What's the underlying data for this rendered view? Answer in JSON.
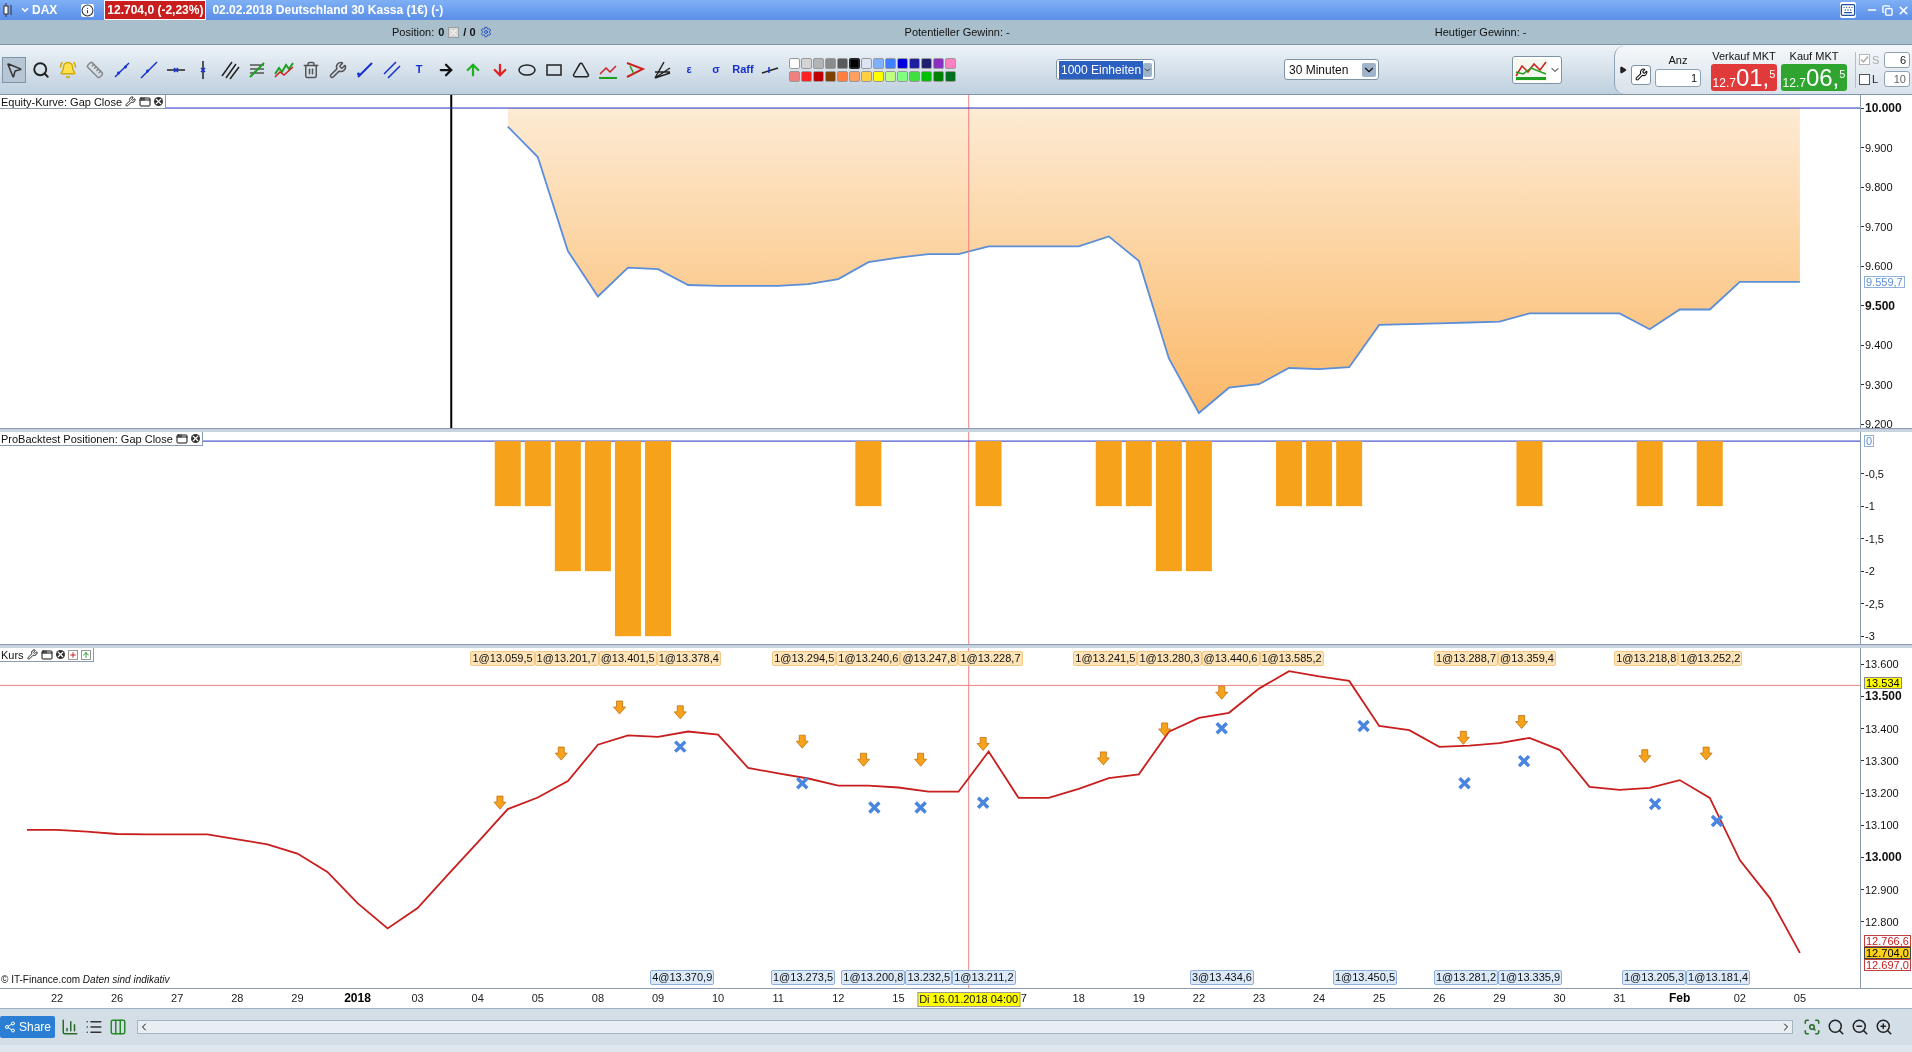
{
  "window": {
    "symbol": "DAX",
    "price_badge": "12.704,0 (-2,23%)",
    "title": "02.02.2018 Deutschland 30 Kassa (1€) (-)"
  },
  "info_bar": {
    "position_label": "Position:",
    "position_value": "0",
    "position_sep": "/ 0",
    "potential_gain": "Potentieller Gewinn: -",
    "today_gain": "Heutiger Gewinn: -"
  },
  "toolbar": {
    "tools": [
      {
        "kind": "icon",
        "selected": true
      },
      {
        "kind": "icon",
        "selected": false
      },
      {
        "kind": "icon",
        "selected": false
      },
      {
        "kind": "icon",
        "selected": false
      },
      {
        "kind": "icon",
        "selected": false
      },
      {
        "kind": "icon",
        "selected": false
      },
      {
        "kind": "icon",
        "selected": false
      },
      {
        "kind": "icon",
        "selected": false
      },
      {
        "kind": "icon",
        "selected": false
      },
      {
        "kind": "icon",
        "selected": false
      },
      {
        "kind": "icon",
        "selected": false
      },
      {
        "kind": "icon",
        "selected": false
      },
      {
        "kind": "icon",
        "selected": false
      },
      {
        "kind": "icon",
        "selected": false
      },
      {
        "kind": "icon",
        "selected": false
      },
      {
        "kind": "glyph",
        "label": "T",
        "selected": false
      },
      {
        "kind": "icon",
        "selected": false
      },
      {
        "kind": "icon",
        "selected": false
      },
      {
        "kind": "icon",
        "selected": false
      },
      {
        "kind": "icon",
        "selected": false
      },
      {
        "kind": "icon",
        "selected": false
      },
      {
        "kind": "icon",
        "selected": false
      },
      {
        "kind": "icon",
        "selected": false
      },
      {
        "kind": "icon",
        "selected": false
      },
      {
        "kind": "icon",
        "selected": false
      },
      {
        "kind": "glyph",
        "label": "ε",
        "selected": false
      },
      {
        "kind": "glyph",
        "label": "σ",
        "selected": false
      },
      {
        "kind": "glyph",
        "label": "Raff",
        "selected": false
      },
      {
        "kind": "icon",
        "selected": false
      }
    ],
    "palette": [
      [
        {
          "color": "#ffffff",
          "selected": false
        },
        {
          "color": "#d4d4d4",
          "selected": false
        },
        {
          "color": "#b4b4b4",
          "selected": false
        },
        {
          "color": "#8c8c8c",
          "selected": false
        },
        {
          "color": "#5a5a5a",
          "selected": false
        },
        {
          "color": "#000000",
          "selected": true
        },
        {
          "color": "#dce4f4",
          "selected": false
        },
        {
          "color": "#7fb0ff",
          "selected": false
        },
        {
          "color": "#3f7fff",
          "selected": false
        },
        {
          "color": "#0000dd",
          "selected": false
        },
        {
          "color": "#1e1ea0",
          "selected": false
        },
        {
          "color": "#20206e",
          "selected": false
        },
        {
          "color": "#8a2fc0",
          "selected": false
        },
        {
          "color": "#ff80c0",
          "selected": false
        }
      ],
      [
        {
          "color": "#f08080",
          "selected": false
        },
        {
          "color": "#ff2020",
          "selected": false
        },
        {
          "color": "#c00000",
          "selected": false
        },
        {
          "color": "#804000",
          "selected": false
        },
        {
          "color": "#ff8040",
          "selected": false
        },
        {
          "color": "#ffa060",
          "selected": false
        },
        {
          "color": "#ffd040",
          "selected": false
        },
        {
          "color": "#ffff00",
          "selected": false
        },
        {
          "color": "#c0ff80",
          "selected": false
        },
        {
          "color": "#80ff80",
          "selected": false
        },
        {
          "color": "#40e040",
          "selected": false
        },
        {
          "color": "#00c000",
          "selected": false
        },
        {
          "color": "#008000",
          "selected": false
        },
        {
          "color": "#007020",
          "selected": false
        }
      ]
    ],
    "units": {
      "value": "1000 Einheiten",
      "selected": true
    },
    "period": {
      "value": "30 Minuten",
      "selected": false
    }
  },
  "order_panel": {
    "quantity_label": "Anz",
    "quantity": "1",
    "sell_label": "Verkauf MKT",
    "sell": {
      "prefix": "12.7",
      "main": "01,",
      "sup": "5"
    },
    "buy_label": "Kauf MKT",
    "buy": {
      "prefix": "12.7",
      "main": "06,",
      "sup": "5"
    },
    "options": [
      {
        "label": "S",
        "checked": true,
        "disabled": true,
        "value": "6"
      },
      {
        "label": "L",
        "checked": false,
        "disabled": false,
        "value": "10"
      }
    ]
  },
  "panels": [
    {
      "kind": "equity",
      "title": "Equity-Kurve: Gap Close",
      "buttons": [
        {
          "kind": "wrench"
        },
        {
          "kind": "window"
        },
        {
          "kind": "close"
        }
      ],
      "badges": [
        {
          "kind": "last"
        }
      ],
      "chart_data": {
        "type": "line",
        "ylim": [
          9190,
          10033
        ],
        "yticks": [
          {
            "value": 10000,
            "label": "10.000"
          },
          {
            "value": 9900,
            "label": "9.900"
          },
          {
            "value": 9800,
            "label": "9.800"
          },
          {
            "value": 9700,
            "label": "9.700"
          },
          {
            "value": 9600,
            "label": "9.600"
          },
          {
            "value": 9500,
            "label": "9.500"
          },
          {
            "value": 9400,
            "label": "9.400"
          },
          {
            "value": 9300,
            "label": "9.300"
          },
          {
            "value": 9200,
            "label": "9.200"
          }
        ],
        "categories": [
          null,
          null,
          null,
          null,
          null,
          null,
          null,
          null,
          null,
          null,
          null,
          null,
          null,
          null,
          null,
          null,
          null,
          null,
          null,
          null,
          null,
          null,
          null,
          null,
          null,
          null,
          null,
          null,
          null,
          null,
          null,
          null,
          null,
          null,
          null,
          null,
          null,
          null,
          null,
          null,
          null,
          null,
          null,
          null,
          null,
          null,
          null,
          null,
          null,
          null,
          null,
          null,
          null,
          null,
          null,
          null,
          null,
          null,
          null,
          null
        ],
        "series": [
          {
            "color": "#5b8ed8",
            "values": [
              null,
              null,
              null,
              null,
              null,
              null,
              null,
              null,
              null,
              null,
              null,
              null,
              null,
              null,
              null,
              null,
              9953,
              9876,
              9638,
              9523,
              9596,
              9592,
              9552,
              9550,
              9550,
              9550,
              9554,
              9567,
              9610,
              9621,
              9630,
              9630,
              9650,
              9650,
              9650,
              9650,
              9675,
              9613,
              9366,
              9228,
              9292,
              9301,
              9342,
              9339,
              9344,
              9451,
              9453,
              9455,
              9457,
              9459,
              9480,
              9480,
              9480,
              9480,
              9440,
              9490,
              9490,
              9560,
              9560,
              9560
            ]
          }
        ],
        "ref_lines": [
          {
            "axis": "y",
            "value": 10000
          }
        ],
        "annotations": [
          "9.559,7"
        ]
      }
    },
    {
      "kind": "positions",
      "title": "ProBacktest Positionen: Gap Close",
      "buttons": [
        {
          "kind": "window"
        },
        {
          "kind": "close"
        }
      ],
      "badges": [
        {
          "kind": "baseline"
        }
      ],
      "chart_data": {
        "type": "bar",
        "ylim": [
          -3.12,
          0.14
        ],
        "yticks": [
          {
            "value": -0.5,
            "label": "-0,5"
          },
          {
            "value": -1,
            "label": "-1"
          },
          {
            "value": -1.5,
            "label": "-1,5"
          },
          {
            "value": -2,
            "label": "-2"
          },
          {
            "value": -2.5,
            "label": "-2,5"
          },
          {
            "value": -3,
            "label": "-3"
          }
        ],
        "categories": [
          null,
          null,
          null,
          null,
          null,
          null,
          null,
          null,
          null,
          null,
          null,
          null,
          null,
          null,
          null,
          null,
          null,
          null,
          null,
          null,
          null,
          null,
          null,
          null,
          null,
          null,
          null,
          null,
          null,
          null,
          null,
          null,
          null,
          null,
          null,
          null,
          null,
          null,
          null,
          null,
          null,
          null,
          null,
          null,
          null,
          null,
          null,
          null,
          null,
          null,
          null,
          null,
          null,
          null,
          null,
          null,
          null,
          null,
          null,
          null
        ],
        "series": [
          {
            "color": "#f7a21b",
            "values": [
              null,
              null,
              null,
              null,
              null,
              null,
              null,
              null,
              null,
              null,
              null,
              null,
              null,
              null,
              null,
              null,
              -1,
              -1,
              -2,
              -2,
              -3,
              -3,
              null,
              null,
              null,
              null,
              null,
              null,
              -1,
              null,
              null,
              null,
              -1,
              null,
              null,
              null,
              -1,
              -1,
              -2,
              -2,
              null,
              null,
              -1,
              -1,
              -1,
              null,
              null,
              null,
              null,
              null,
              -1,
              null,
              null,
              null,
              -1,
              null,
              -1,
              null,
              null,
              null
            ]
          }
        ],
        "ref_lines": [
          {
            "axis": "y",
            "value": 0
          }
        ],
        "annotations": [
          "0"
        ]
      }
    },
    {
      "kind": "price",
      "title": "Kurs",
      "buttons": [
        {
          "kind": "wrench"
        },
        {
          "kind": "window"
        },
        {
          "kind": "close"
        },
        {
          "kind": "add"
        },
        {
          "kind": "up"
        }
      ],
      "badges": [
        {
          "kind": "cursor"
        },
        {
          "kind": "high"
        },
        {
          "kind": "current"
        },
        {
          "kind": "low"
        }
      ],
      "cursor_label": "Di 16.01.2018 04:00",
      "partial_tick": "7",
      "date_bold": [
        false,
        false,
        false,
        false,
        false,
        true,
        false,
        false,
        false,
        false,
        false,
        false,
        false,
        false,
        false,
        false,
        false,
        false,
        false,
        false,
        false,
        false,
        false,
        false,
        false,
        true,
        false,
        false
      ],
      "chart_data": {
        "type": "line",
        "ylim": [
          12595,
          13650
        ],
        "categories": [
          null,
          "22",
          null,
          "26",
          null,
          "27",
          null,
          "28",
          null,
          "29",
          null,
          "2018",
          null,
          "03",
          null,
          "04",
          null,
          "05",
          null,
          "08",
          null,
          "09",
          null,
          "10",
          null,
          "11",
          null,
          "12",
          null,
          "15",
          null,
          null,
          null,
          null,
          null,
          "18",
          null,
          "19",
          null,
          "22",
          null,
          "23",
          null,
          "24",
          null,
          "25",
          null,
          "26",
          null,
          "29",
          null,
          "30",
          null,
          "31",
          null,
          "Feb",
          null,
          "02",
          null,
          "05"
        ],
        "yticks": [
          {
            "value": 13600,
            "label": "13.600"
          },
          {
            "value": 13500,
            "label": "13.500"
          },
          {
            "value": 13400,
            "label": "13.400"
          },
          {
            "value": 13300,
            "label": "13.300"
          },
          {
            "value": 13200,
            "label": "13.200"
          },
          {
            "value": 13100,
            "label": "13.100"
          },
          {
            "value": 13000,
            "label": "13.000"
          },
          {
            "value": 12900,
            "label": "12.900"
          },
          {
            "value": 12800,
            "label": "12.800"
          }
        ],
        "series": [
          {
            "color": "#c81e1e",
            "values": [
              13086,
              13086,
              13080,
              13073,
              13072,
              13072,
              13072,
              13056,
              13041,
              13012,
              12955,
              12858,
              12780,
              12843,
              12946,
              13047,
              13150,
              13186,
              13237,
              13350,
              13379,
              13374,
              13391,
              13381,
              13278,
              13261,
              13245,
              13223,
              13223,
              13217,
              13204,
              13204,
              13329,
              13185,
              13185,
              13213,
              13246,
              13258,
              13390,
              13433,
              13449,
              13524,
              13578,
              13562,
              13548,
              13408,
              13395,
              13343,
              13347,
              13355,
              13371,
              13334,
              13219,
              13210,
              13216,
              13240,
              13185,
              12992,
              12874,
              12704
            ]
          }
        ],
        "ref_lines": [
          {
            "axis": "y",
            "value": 13534
          }
        ],
        "annotations": [
          "13.534",
          "12.766,6",
          "12.704,0",
          "12.697,0"
        ]
      },
      "top_labels": [
        [
          "1@13.059,5",
          "1@13.201,7",
          "@13.401,5",
          "1@13.378,4"
        ],
        [
          "1@13.294,5",
          "1@13.240,6",
          "@13.247,8",
          "1@13.228,7"
        ],
        [
          "1@13.241,5",
          "1@13.280,3",
          "@13.440,6",
          "1@13.585,2"
        ],
        [
          "1@13.288,7",
          "@13.359,4"
        ],
        [
          "1@13.218,8",
          "1@13.252,2"
        ]
      ],
      "bottom_labels": [
        [
          "4@13.370,9"
        ],
        [
          "1@13.273,5"
        ],
        [
          "1@13.200,8",
          "13.232,5",
          "1@13.211,2"
        ],
        [
          "3@13.434,6"
        ],
        [
          "1@13.450,5"
        ],
        [
          "1@13.281,2",
          "1@13.335,9"
        ],
        [
          "1@13.205,3",
          "1@13.181,4"
        ]
      ],
      "copyright": "© IT-Finance.com *Daten sind indikativ*"
    }
  ],
  "bottom_bar": {
    "share": "Share"
  }
}
